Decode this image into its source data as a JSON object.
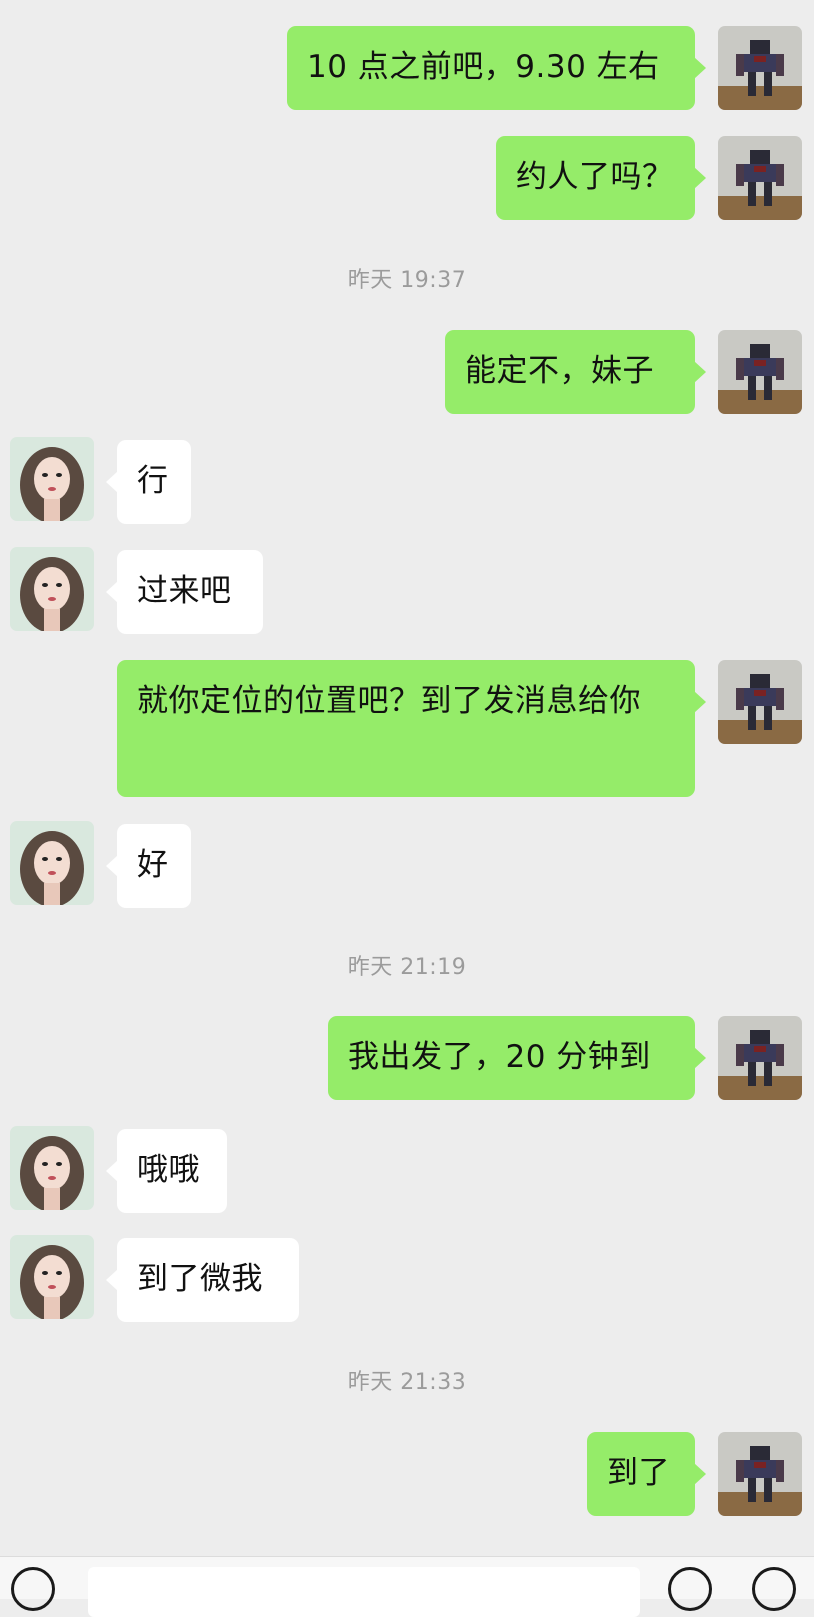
{
  "messages": [
    {
      "from": "me",
      "text": "10 点之前吧，9.30 左右"
    },
    {
      "from": "me",
      "text": "约人了吗？"
    },
    {
      "type": "time",
      "text": "昨天 19:37"
    },
    {
      "from": "me",
      "text": "能定不，妹子"
    },
    {
      "from": "them",
      "text": "行"
    },
    {
      "from": "them",
      "text": "过来吧"
    },
    {
      "from": "me",
      "text": "就你定位的位置吧？到了发消息给你"
    },
    {
      "from": "them",
      "text": "好"
    },
    {
      "type": "time",
      "text": "昨天 21:19"
    },
    {
      "from": "me",
      "text": "我出发了，20 分钟到"
    },
    {
      "from": "them",
      "text": "哦哦"
    },
    {
      "from": "them",
      "text": "到了微我"
    },
    {
      "type": "time",
      "text": "昨天 21:33"
    },
    {
      "from": "me",
      "text": "到了"
    }
  ],
  "icons": {
    "my_avatar": "robot-avatar-icon",
    "their_avatar": "girl-avatar-icon",
    "voice": "voice-icon",
    "emoji": "emoji-icon",
    "plus": "plus-icon"
  },
  "colors": {
    "background": "#ededed",
    "my_bubble": "#95ec69",
    "their_bubble": "#ffffff",
    "timestamp": "#9b9b9b"
  }
}
